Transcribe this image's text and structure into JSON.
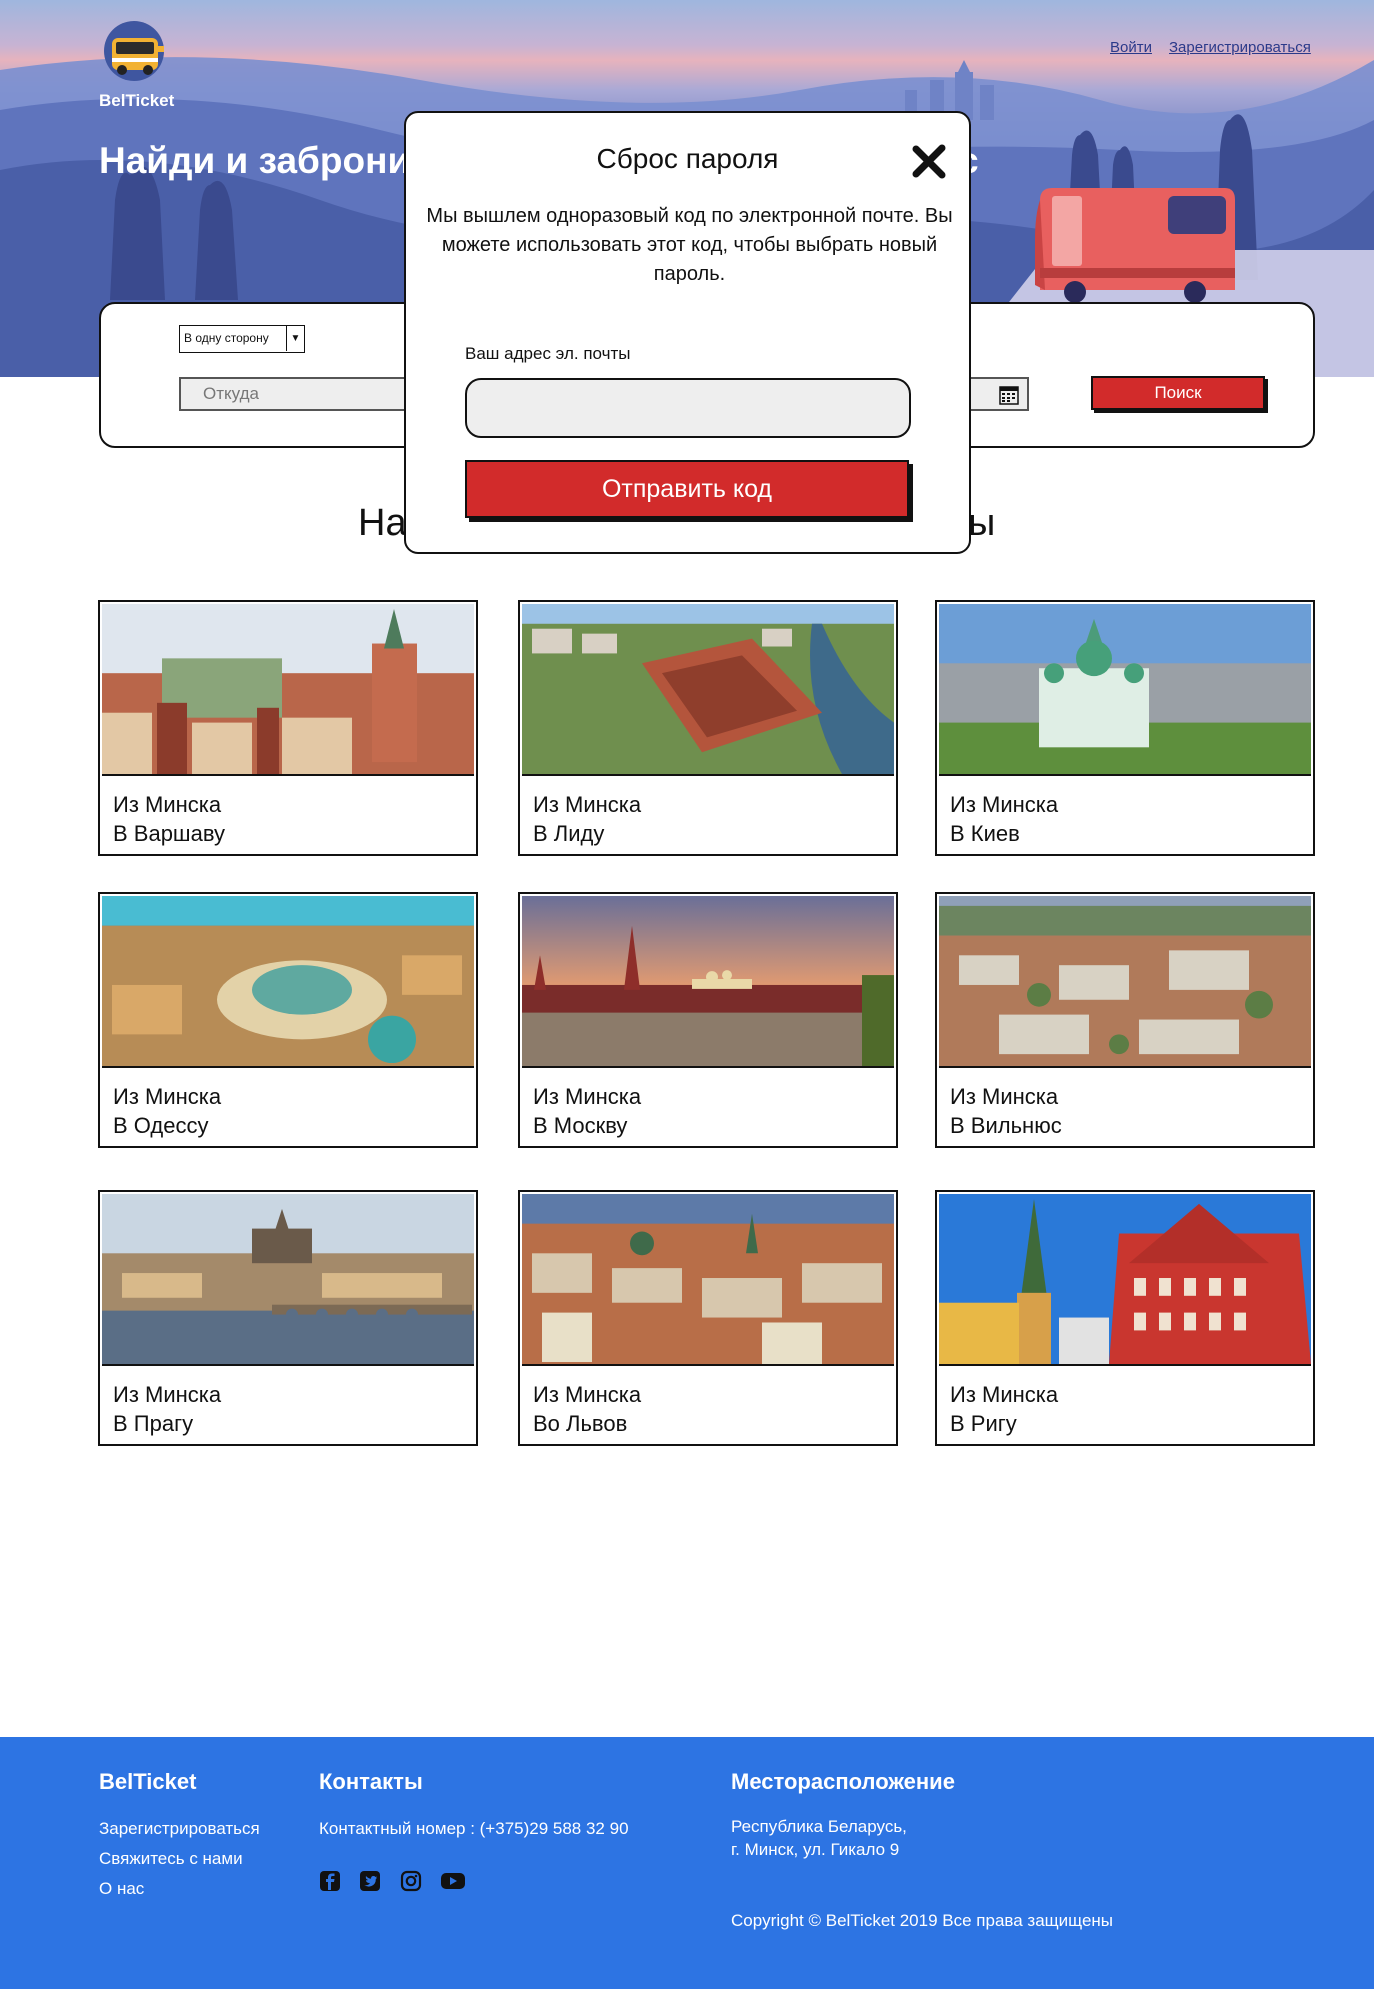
{
  "header": {
    "brand": "BelTicket",
    "login_link": "Войти",
    "register_link": "Зарегистрироваться",
    "headline_visible": "Найди и заброни",
    "headline_tail_visible": "с"
  },
  "search": {
    "trip_type": "В одну сторону",
    "from_placeholder": "Откуда",
    "search_button": "Поиск"
  },
  "section": {
    "title_left_visible": "На",
    "title_right_visible": "ы"
  },
  "routes": [
    {
      "from": "Из Минска",
      "to": "В Варшаву"
    },
    {
      "from": "Из Минска",
      "to": "В Лиду"
    },
    {
      "from": "Из Минска",
      "to": "В Киев"
    },
    {
      "from": "Из Минска",
      "to": "В Одессу"
    },
    {
      "from": "Из Минска",
      "to": "В Москву"
    },
    {
      "from": "Из Минска",
      "to": "В Вильнюс"
    },
    {
      "from": "Из Минска",
      "to": "В Прагу"
    },
    {
      "from": "Из Минска",
      "to": "Во Львов"
    },
    {
      "from": "Из Минска",
      "to": "В Ригу"
    }
  ],
  "modal": {
    "title": "Сброс пароля",
    "description": "Мы вышлем одноразовый код по электронной почте. Вы можете использовать этот код, чтобы выбрать новый пароль.",
    "email_label": "Ваш адрес эл. почты",
    "email_value": "",
    "submit_button": "Отправить код"
  },
  "footer": {
    "brand": "BelTicket",
    "links": [
      "Зарегистрироваться",
      "Свяжитесь с нами",
      "О нас"
    ],
    "contacts_title": "Контакты",
    "phone": "Контактный номер : (+375)29 588 32 90",
    "social_icons": [
      "facebook-icon",
      "twitter-icon",
      "instagram-icon",
      "youtube-icon"
    ],
    "location_title": "Месторасположение",
    "address_line1": "Республика Беларусь,",
    "address_line2": "г. Минск, ул. Гикало 9",
    "copyright": "Copyright © BelTicket 2019 Все права защищены"
  },
  "colors": {
    "accent_red": "#d22b2b",
    "footer_blue": "#2d74e3",
    "hero_blue": "#556bb3"
  }
}
